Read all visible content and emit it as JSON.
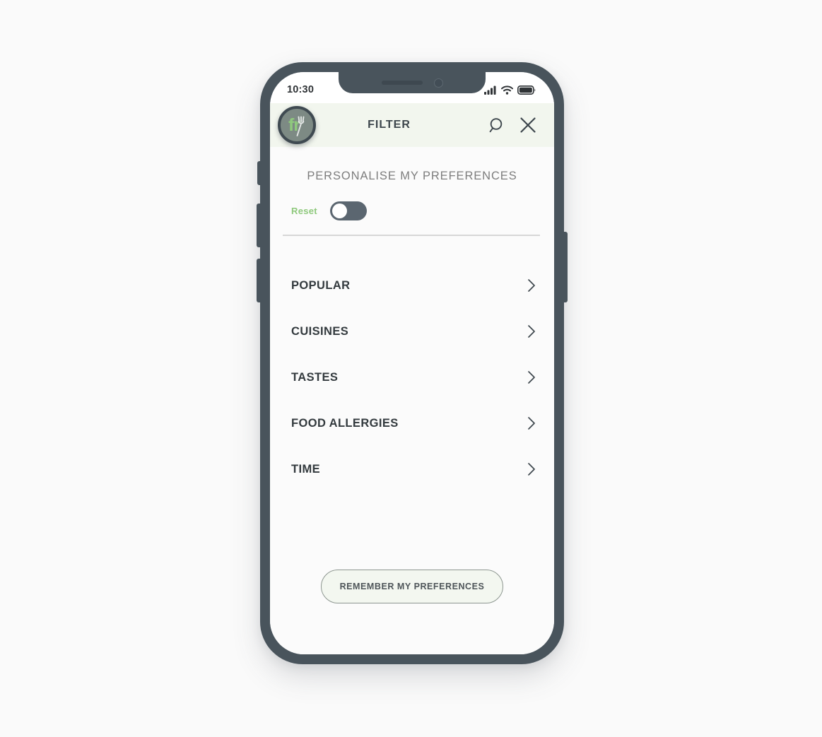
{
  "status_bar": {
    "time": "10:30",
    "icons": [
      "signal-icon",
      "wifi-icon",
      "battery-icon"
    ]
  },
  "header": {
    "logo_text": "fr",
    "logo_icon": "fork-icon",
    "title": "FILTER",
    "search_icon": "search-icon",
    "close_icon": "close-icon"
  },
  "preferences": {
    "section_title": "PERSONALISE MY PREFERENCES",
    "reset_label": "Reset",
    "reset_toggle_on": false
  },
  "menu": {
    "items": [
      {
        "label": "POPULAR",
        "chevron": "chevron-right-icon"
      },
      {
        "label": "CUISINES",
        "chevron": "chevron-right-icon"
      },
      {
        "label": "TASTES",
        "chevron": "chevron-right-icon"
      },
      {
        "label": "FOOD ALLERGIES",
        "chevron": "chevron-right-icon"
      },
      {
        "label": "TIME",
        "chevron": "chevron-right-icon"
      }
    ]
  },
  "footer": {
    "remember_label": "REMEMBER MY PREFERENCES"
  },
  "colors": {
    "frame": "#49545c",
    "header_bg": "#f2f6ee",
    "accent_green": "#8fc97d",
    "text_dark": "#333a3e",
    "text_muted": "#7d7d7d",
    "toggle_track": "#5b6670"
  }
}
